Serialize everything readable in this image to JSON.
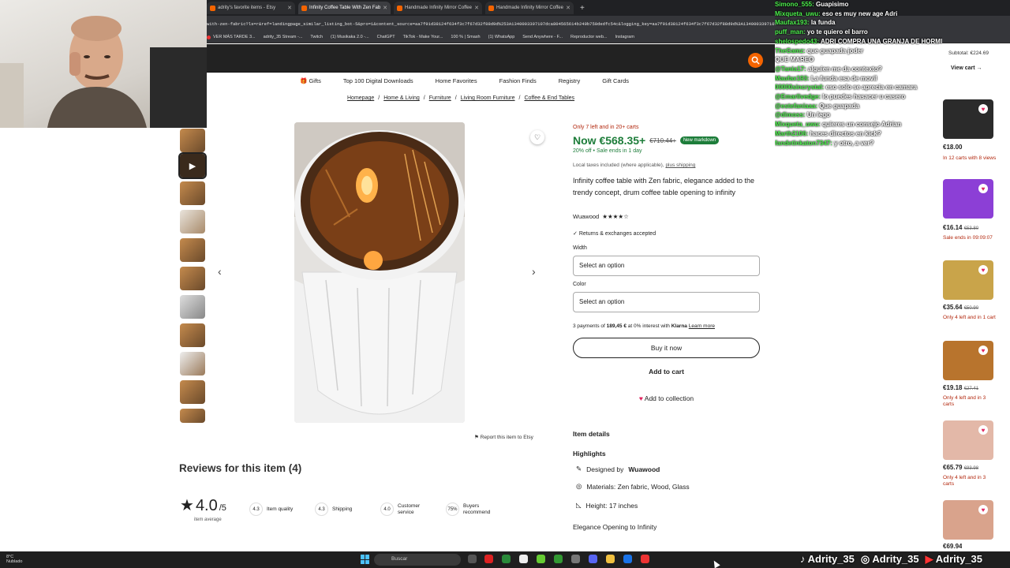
{
  "browser": {
    "tabs": [
      {
        "label": "adrity's favorite items - Etsy",
        "active": false
      },
      {
        "label": "Infinity Coffee Table With Zen Fab",
        "active": true
      },
      {
        "label": "Handmade Infinity Mirror Coffee",
        "active": false
      },
      {
        "label": "Handmade Infinity Mirror Coffee",
        "active": false
      }
    ],
    "url": "with-zen-fabric?ls=r&ref=landingpage_similar_listing_bot-5&pro=1&content_source=aa7f91d38124f634f3c7f67d32f88d9d%253A1340003397107dca804565614b249b750dedfc54c&logging_key=aa7f91d38124f634f3c7f67d32f88d9d%3A1340003397107",
    "bookmarks": [
      "VER MÁS TARDE 3...",
      "adrity_35 Stream -...",
      "Twitch",
      "(1) Musikaka 2.0 -...",
      "ChatGPT",
      "TikTok - Make Your...",
      "100 % | Smash",
      "(1) WhatsApp",
      "Send Anywhere - F...",
      "Reproductor web...",
      "Instagram"
    ]
  },
  "nav": {
    "categories": [
      "Gifts",
      "Top 100 Digital Downloads",
      "Home Favorites",
      "Fashion Finds",
      "Registry",
      "Gift Cards"
    ]
  },
  "breadcrumb": [
    "Homepage",
    "Home & Living",
    "Furniture",
    "Living Room Furniture",
    "Coffee & End Tables"
  ],
  "listing": {
    "stock": "Only 7 left and in 20+ carts",
    "price": "Now €568.35+",
    "old_price": "€710.44+",
    "badge": "New markdown",
    "discount": "20% off  •  Sale ends in 1 day",
    "tax": "Local taxes included (where applicable),",
    "tax_link": "plus shipping",
    "title": "Infinity coffee table with Zen fabric, elegance added to the trendy concept, drum coffee table opening to infinity",
    "shop": "Wuawood",
    "stars": "★★★★☆",
    "returns": "Returns & exchanges accepted",
    "width_label": "Width",
    "width_value": "Select an option",
    "color_label": "Color",
    "color_value": "Select an option",
    "klarna_pre": "3 payments of",
    "klarna_amount": "189,45 €",
    "klarna_post": "at 0% interest with",
    "klarna_brand": "Klarna",
    "klarna_link": "Learn more",
    "buy_now": "Buy it now",
    "add_cart": "Add to cart",
    "add_collection": "Add to collection",
    "report": "Report this item to Etsy",
    "item_details": "Item details",
    "highlights_label": "Highlights",
    "designed_by_pre": "Designed by",
    "designed_by": "Wuawood",
    "materials": "Materials: Zen fabric, Wood, Glass",
    "height": "Height: 17 inches",
    "highlight_text": "Elegance Opening to Infinity"
  },
  "reviews": {
    "title": "Reviews for this item (4)",
    "rating": "4.0",
    "rating_out_of": "/5",
    "rating_sub": "item average",
    "stats": [
      {
        "value": "4.3",
        "label": "Item quality"
      },
      {
        "value": "4.3",
        "label": "Shipping"
      },
      {
        "value": "4.0",
        "label": "Customer service"
      },
      {
        "value": "75%",
        "label": "Buyers recommend"
      }
    ]
  },
  "chat": [
    {
      "user": "Simono_555:",
      "msg": "Guapisimo"
    },
    {
      "user": "Mixqueta_uwu:",
      "msg": "eso es muy new age Adri"
    },
    {
      "user": "Maufax193:",
      "msg": "la funda"
    },
    {
      "user": "puff_man:",
      "msg": "yo te quiero el barro"
    },
    {
      "user": "shelospedo43:",
      "msg": "ADRI COMPRA UNA GRANJA DE HORMIGAS"
    },
    {
      "user": "TheGamz:",
      "msg": "que guapada joder"
    },
    {
      "user": "",
      "msg": "QUE MAREO"
    },
    {
      "user": "@Tania17:",
      "msg": "alguien me da contexto?"
    },
    {
      "user": "Maufax193:",
      "msg": "La funda esa de movil"
    },
    {
      "user": "00000sincrystal:",
      "msg": "eso solo se aprecia en camara"
    },
    {
      "user": "@Emarlivedge:",
      "msg": "lo puedes hasacer u casero"
    },
    {
      "user": "@estefaniaaa:",
      "msg": "Que guapada"
    },
    {
      "user": "@dimoss:",
      "msg": "Un lego"
    },
    {
      "user": "Mixqueta_uwu:",
      "msg": "quieres un consejo Adrian"
    },
    {
      "user": "Marth2106:",
      "msg": "haces directos en kick?"
    },
    {
      "user": "fandetinkaton7347:",
      "msg": "y otro, a ver?"
    }
  ],
  "cart_panel": {
    "subtotal": "Subtotal: €224.69",
    "view_cart": "View cart →"
  },
  "side_products": [
    {
      "price": "€18.00",
      "old": "",
      "note": "In 12 carts with 8 views",
      "color": "#2b2b2b"
    },
    {
      "price": "€16.14",
      "old": "€53.80",
      "note": "Sale ends in 09:09:07",
      "color": "#8c3fd6"
    },
    {
      "price": "€35.64",
      "old": "€50.90",
      "note": "Only 4 left and in 1 cart",
      "color": "#c9a44a"
    },
    {
      "price": "€19.18",
      "old": "€27.41",
      "note": "Only 4 left and in 3 carts",
      "color": "#b8742d"
    },
    {
      "price": "€65.79",
      "old": "€93.98",
      "note": "Only 4 left and in 3 carts",
      "color": "#e3b8a8"
    },
    {
      "price": "€69.94",
      "old": "",
      "note": "",
      "color": "#d9a38c"
    }
  ],
  "taskbar": {
    "search": "Buscar",
    "weather_temp": "8°C",
    "weather_desc": "Nublado"
  },
  "socials": [
    "Adrity_35",
    "Adrity_35",
    "Adrity_35"
  ],
  "colors": {
    "etsy_orange": "#f56400",
    "price_green": "#1d7d3a",
    "alert_red": "#b2270d"
  }
}
